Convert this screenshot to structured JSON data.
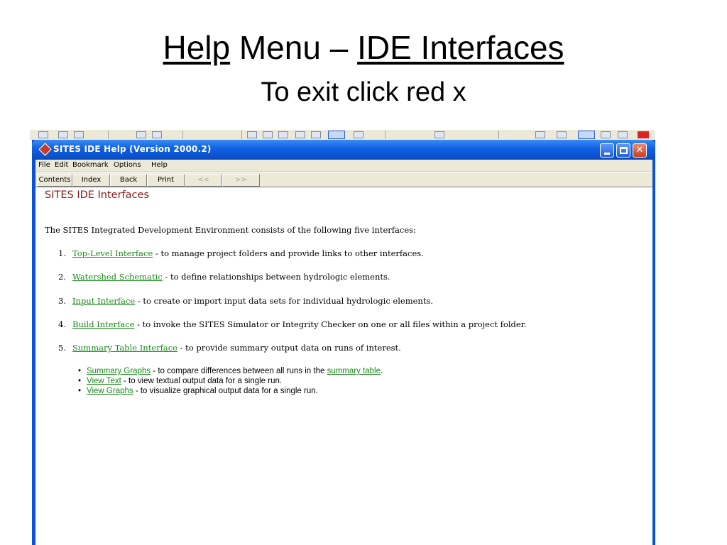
{
  "slide": {
    "title_part1": "Help",
    "title_part2": " Menu – ",
    "title_part3": "IDE Interfaces",
    "subtitle": "To exit click red x"
  },
  "window": {
    "title": "SITES IDE Help (Version 2000.2)",
    "controls": {
      "minimize_icon": "minimize-icon",
      "maximize_icon": "maximize-icon",
      "close_glyph": "✕"
    },
    "menu": [
      "File",
      "Edit",
      "Bookmark",
      "Options",
      "Help"
    ],
    "buttons": [
      {
        "label": "Contents",
        "enabled": true
      },
      {
        "label": "Index",
        "enabled": true
      },
      {
        "label": "Back",
        "enabled": true
      },
      {
        "label": "Print",
        "enabled": true
      },
      {
        "label": "<<",
        "enabled": false
      },
      {
        "label": ">>",
        "enabled": false
      }
    ]
  },
  "content": {
    "heading": "SITES IDE Interfaces",
    "intro": "The SITES Integrated Development Environment consists of the following five interfaces:",
    "items": [
      {
        "num": "1.",
        "link": "Top-Level Interface",
        "desc": " - to manage project folders and provide links to other interfaces."
      },
      {
        "num": "2.",
        "link": "Watershed Schematic",
        "desc": " - to define relationships between hydrologic elements."
      },
      {
        "num": "3.",
        "link": "Input Interface",
        "desc": " - to create or import input data sets for individual hydrologic elements."
      },
      {
        "num": "4.",
        "link": "Build Interface",
        "desc": " - to invoke the SITES Simulator or Integrity Checker on one or all files within a project folder."
      },
      {
        "num": "5.",
        "link": "Summary Table Interface",
        "desc": " - to provide summary output data on runs of interest."
      }
    ],
    "bullets": [
      {
        "link": "Summary Graphs",
        "desc": " - to compare differences between all runs in the ",
        "link2": "summary table",
        "tail": "."
      },
      {
        "link": "View Text",
        "desc": " - to view textual output data for a single run."
      },
      {
        "link": "View Graphs",
        "desc": " - to visualize graphical output data for a single run."
      }
    ]
  }
}
